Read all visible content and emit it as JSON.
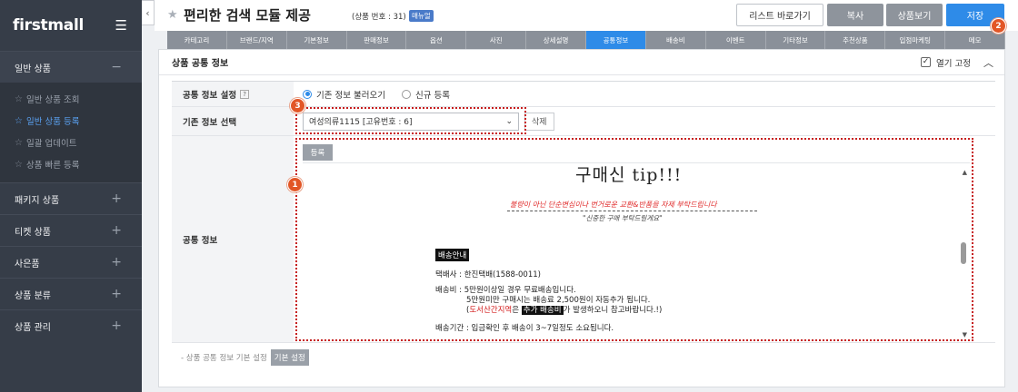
{
  "sidebar": {
    "brand": "firstmall",
    "groups": [
      {
        "label": "일반 상품",
        "symbol": "−"
      },
      {
        "label": "패키지 상품",
        "symbol": "+"
      },
      {
        "label": "티켓 상품",
        "symbol": "+"
      },
      {
        "label": "사은품",
        "symbol": "+"
      },
      {
        "label": "상품 분류",
        "symbol": "+"
      },
      {
        "label": "상품 관리",
        "symbol": "+"
      }
    ],
    "sub_items": [
      {
        "label": "일반 상품 조회",
        "active": false
      },
      {
        "label": "일반 상품 등록",
        "active": true
      },
      {
        "label": "일괄 업데이트",
        "active": false
      },
      {
        "label": "상품 빠른 등록",
        "active": false
      }
    ]
  },
  "header": {
    "title": "편리한 검색 모듈 제공",
    "goods_no": "(상품 번호 : 31)",
    "manual_badge": "매뉴얼",
    "buttons": {
      "list": "리스트 바로가기",
      "copy": "복사",
      "view": "상품보기",
      "save": "저장"
    }
  },
  "tabs": [
    "카테고리",
    "브랜드/지역",
    "기본정보",
    "판매정보",
    "옵션",
    "사진",
    "상세설명",
    "공통정보",
    "배송비",
    "이벤트",
    "기타정보",
    "추천상품",
    "입점마케팅",
    "메모"
  ],
  "active_tab": "공통정보",
  "panel": {
    "title": "상품 공통 정보",
    "fix_label": "열기 고정",
    "fix_checked": true,
    "rows": {
      "setting_label": "공통 정보 설정",
      "help": "?",
      "radio_existing": "기존 정보 불러오기",
      "radio_new": "신규 등록",
      "select_label": "기존 정보 선택",
      "select_value": "여성의류1115  [고유번호 : 6]",
      "delete_btn": "삭제",
      "info_label": "공통 정보",
      "register_btn": "등록"
    },
    "editor": {
      "tip_title": "구매신 tip!!!",
      "red_line": "불량이 아닌 단순변심이나 번거로운 교환&반품을 자제 부탁드립니다",
      "gray_line": "\"신중한 구매 부탁드릴게요\"",
      "shipping_badge": "배송안내",
      "courier": "택배사 : 한진택배(1588-0011)",
      "fee_line1": "배송비 : 5만원이상일 경우 무료배송입니다.",
      "fee_line2": "5만원미만 구매시는 배송료 2,500원이 자동추가 됩니다.",
      "fee_line3_pre": "(",
      "fee_line3_red": "도서산간지역",
      "fee_line3_mid": "은 ",
      "fee_line3_hl": "추가 배송비",
      "fee_line3_post": "가 발생하오니 참고바랍니다.!)",
      "period": "배송기간 : 입금확인 후 배송이 3~7일정도 소요됩니다."
    },
    "default_label": "- 상품 공통 정보 기본 설정",
    "default_btn": "기본 설정"
  },
  "markers": [
    "1",
    "2",
    "3"
  ],
  "colors": {
    "accent": "#2e8be8",
    "sidebar": "#363d48",
    "marker": "#e25626",
    "highlight_border": "#c61f1f"
  }
}
